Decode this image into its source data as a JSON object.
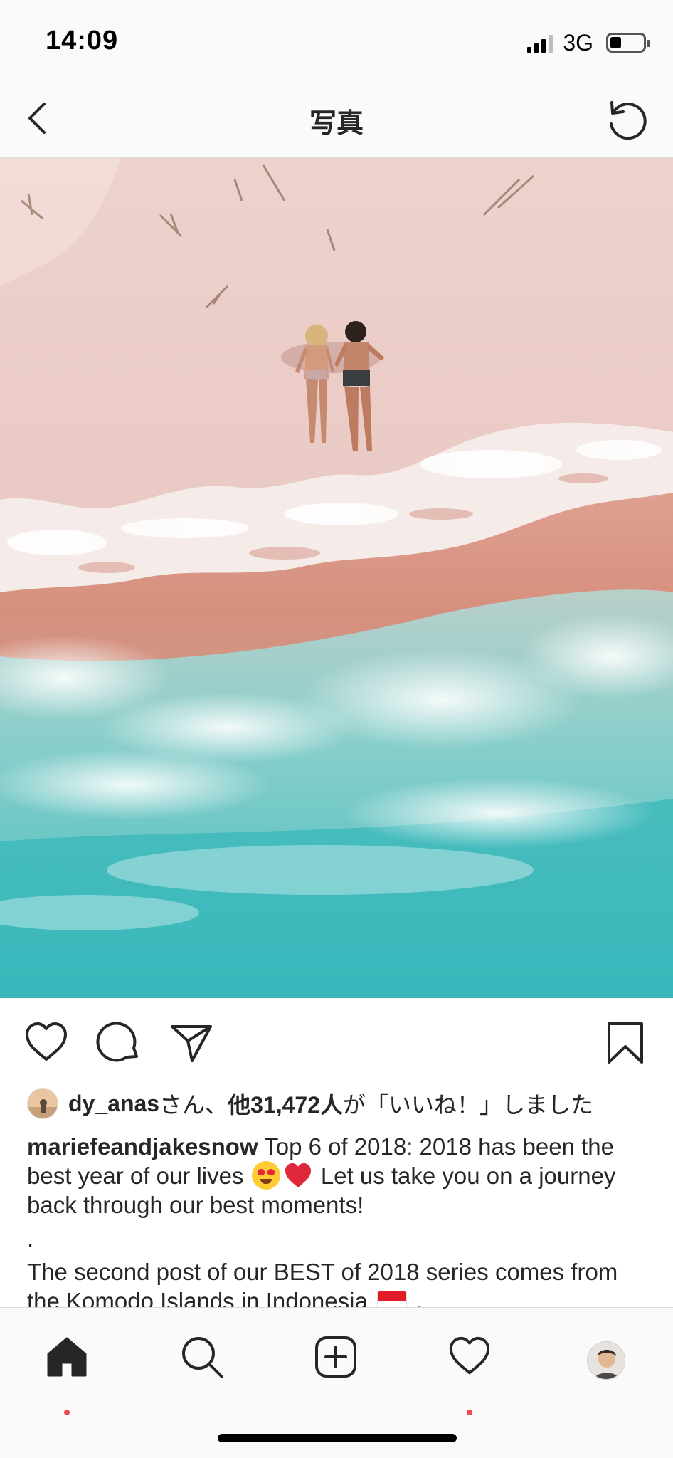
{
  "status_bar": {
    "time": "14:09",
    "network": "3G",
    "signal_bars_filled": 3,
    "signal_bars_total": 4,
    "battery_level": 0.35
  },
  "nav": {
    "title": "写真",
    "back_icon": "chevron-left-icon",
    "refresh_icon": "refresh-icon"
  },
  "actions": {
    "like_icon": "heart-icon",
    "comment_icon": "comment-bubble-icon",
    "share_icon": "paper-plane-icon",
    "save_icon": "bookmark-icon"
  },
  "likes": {
    "user": "dy_anas",
    "connector": "さん、",
    "others": "他31,472人",
    "suffix": "が「いいね！」しました"
  },
  "caption": {
    "username": "mariefeandjakesnow",
    "line1_text": " Top 6 of 2018: 2018 has been the best year of our lives ",
    "line1_after_emoji": " Let us take you on a journey back through our best moments!",
    "separator": ".",
    "line2_text": "The second post of our BEST of 2018 series comes from the Komodo Islands in Indonesia ",
    "line2_end": " ."
  },
  "tab_bar": {
    "tabs": [
      {
        "name": "home",
        "icon": "home-icon",
        "active": true,
        "has_notification": true
      },
      {
        "name": "search",
        "icon": "search-icon",
        "active": false,
        "has_notification": false
      },
      {
        "name": "add",
        "icon": "add-post-icon",
        "active": false,
        "has_notification": false
      },
      {
        "name": "activity",
        "icon": "heart-icon",
        "active": false,
        "has_notification": true
      },
      {
        "name": "profile",
        "icon": "profile-avatar",
        "active": false,
        "has_notification": false
      }
    ]
  },
  "colors": {
    "sand": "#eac9c4",
    "foam": "#f7f0ef",
    "wet_sand": "#d99787",
    "sea": "#4fc4c4",
    "notification": "#ed4956",
    "text": "#262626"
  }
}
